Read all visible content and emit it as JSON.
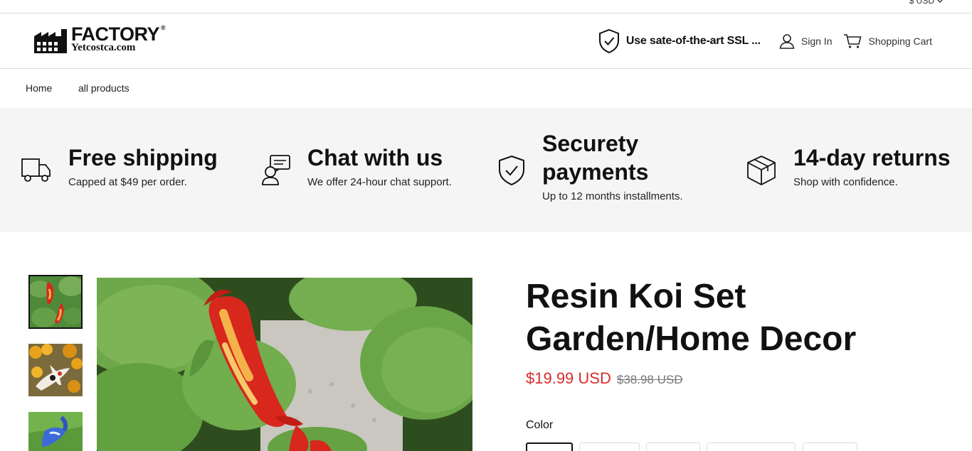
{
  "topbar": {
    "currency": "$ USD"
  },
  "header": {
    "logo_word": "FACTORY",
    "logo_reg": "®",
    "logo_sub": "Yetcostca.com",
    "ssl_text": "Use sate-of-the-art SSL ...",
    "sign_in": "Sign In",
    "cart": "Shopping Cart"
  },
  "nav": {
    "items": [
      {
        "label": "Home"
      },
      {
        "label": "all products"
      }
    ]
  },
  "features": [
    {
      "icon": "truck-icon",
      "title": "Free shipping",
      "desc": "Capped at $49 per order."
    },
    {
      "icon": "chat-support-icon",
      "title": "Chat with us",
      "desc": "We offer 24-hour chat support."
    },
    {
      "icon": "shield-check-icon",
      "title": "Securety payments",
      "desc": "Up to 12 months installments."
    },
    {
      "icon": "box-icon",
      "title": "14-day returns",
      "desc": "Shop with confidence."
    }
  ],
  "gallery": {
    "thumbnails": [
      {
        "alt": "Red koi on leaves"
      },
      {
        "alt": "Koi with flowers"
      },
      {
        "alt": "Blue koi on grass"
      }
    ]
  },
  "product": {
    "title_line1": "Resin Koi Set",
    "title_line2": "Garden/Home Decor",
    "price": "$19.99 USD",
    "old_price": "$38.98 USD",
    "color_label": "Color"
  },
  "colors": {
    "price": "#d92b2b"
  }
}
